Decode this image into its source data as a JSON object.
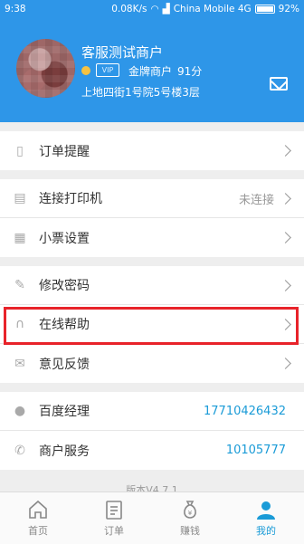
{
  "status_bar": {
    "time": "9:38",
    "speed": "0.08K/s",
    "carrier": "China Mobile 4G",
    "battery": "92%",
    "battery_level": 0.92
  },
  "profile": {
    "name": "客服测试商户",
    "badge": "VIP",
    "level": "金牌商户",
    "score": "91分",
    "address": "上地四街1号院5号楼3层"
  },
  "menu": {
    "order_reminder": "订单提醒",
    "connect_printer": "连接打印机",
    "printer_status": "未连接",
    "receipt_settings": "小票设置",
    "change_password": "修改密码",
    "online_help": "在线帮助",
    "feedback": "意见反馈",
    "manager_label": "百度经理",
    "manager_phone": "17710426432",
    "service_label": "商户服务",
    "service_phone": "10105777"
  },
  "version": "版本V4.7.1",
  "tabs": [
    {
      "label": "首页",
      "icon": "home-icon"
    },
    {
      "label": "订单",
      "icon": "order-icon"
    },
    {
      "label": "赚钱",
      "icon": "money-bag-icon"
    },
    {
      "label": "我的",
      "icon": "user-icon"
    }
  ],
  "colors": {
    "primary": "#2e96e8",
    "highlight": "#e8232a",
    "link": "#1a9bd7"
  }
}
